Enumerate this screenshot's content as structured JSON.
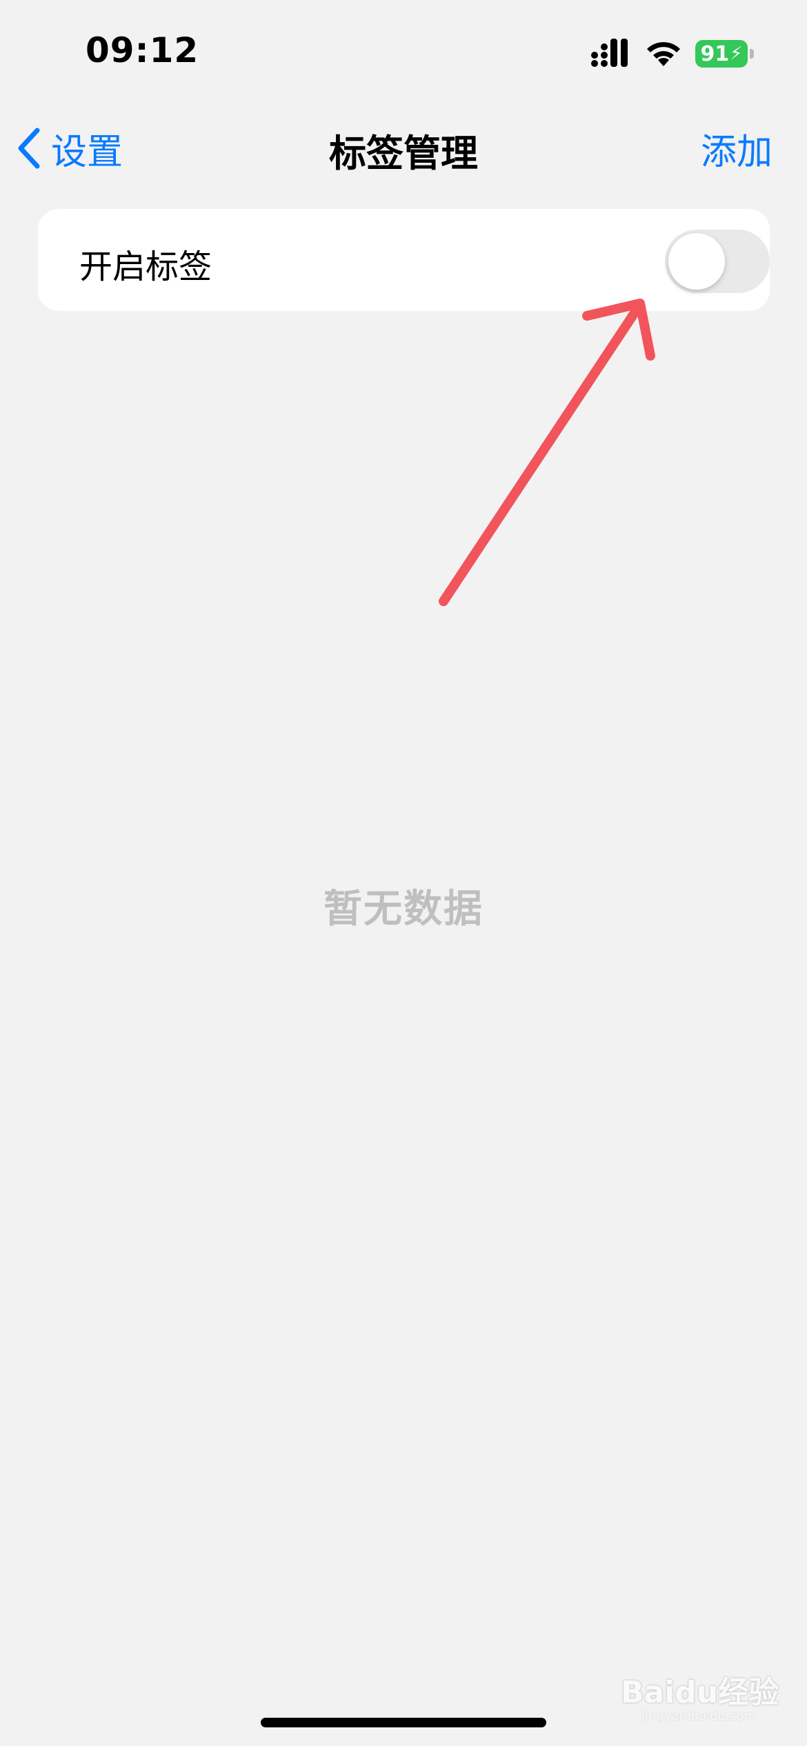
{
  "status_bar": {
    "time": "09:12",
    "battery_level": "91",
    "icons": [
      "signal-icon",
      "wifi-icon",
      "battery-charging-icon"
    ]
  },
  "nav": {
    "back_label": "设置",
    "title": "标签管理",
    "add_label": "添加"
  },
  "settings": {
    "enable_tags_label": "开启标签",
    "enable_tags_on": false
  },
  "empty_state": {
    "text": "暂无数据"
  },
  "watermark": {
    "text": "Baidu经验",
    "subtext": "jingyan.baidu.com"
  },
  "colors": {
    "accent": "#0a7aff",
    "annotation_arrow": "#f2545b",
    "battery": "#34c759"
  }
}
